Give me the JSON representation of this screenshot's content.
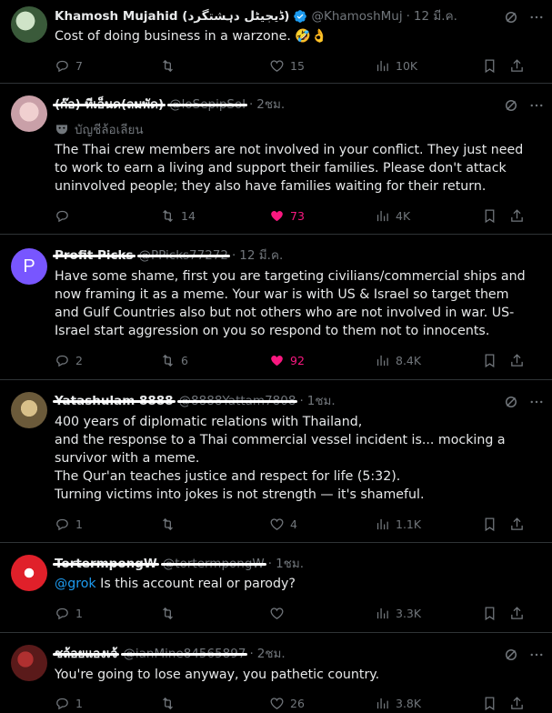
{
  "tweets": [
    {
      "name": "Khamosh Mujahid (ڈیجیٹل دہشتگرد)",
      "verified": true,
      "handle": "@KhamoshMuj",
      "time": "12 มี.ค.",
      "text": [
        "Cost of doing business in a warzone. 🤣👌"
      ],
      "replies": "7",
      "retweets": "",
      "likes": "15",
      "views": "10K",
      "liked": false,
      "avatar_color": "#3a5a3a"
    },
    {
      "name": "(ก๊อ) ทีเอ็นด(ลมพัด)",
      "handle": "@loSepipSol",
      "time": "2ชม.",
      "sub": "บัญชีล้อเลียน",
      "text": [
        "The Thai crew members are not involved in your conflict. They just need to work to earn a living and support their families. Please don't attack uninvolved people; they also have families waiting for their return."
      ],
      "replies": "",
      "retweets": "14",
      "likes": "73",
      "views": "4K",
      "liked": true,
      "avatar_color": "#c9a0a8"
    },
    {
      "name": "Profit Picks",
      "handle": "@PPicks77272",
      "time": "12 มี.ค.",
      "avatar_letter": "P",
      "text": [
        "Have some shame, first you are targeting civilians/commercial ships and now framing it as a meme. Your war is with US & Israel so target them and Gulf Countries also but not others who are not involved in war. US-Israel start aggression on you so respond to them not to innocents."
      ],
      "replies": "2",
      "retweets": "6",
      "likes": "92",
      "views": "8.4K",
      "liked": true,
      "avatar_color": "#7856ff"
    },
    {
      "name": "Yatashulam 8888",
      "handle": "@8888Yattam7808",
      "time": "1ชม.",
      "text": [
        "400 years of diplomatic relations with Thailand,",
        "and the response to a Thai commercial vessel incident is... mocking a survivor with a meme.",
        "The Qur'an teaches justice and respect for life (5:32).",
        "Turning victims into jokes is not strength — it's shameful."
      ],
      "replies": "1",
      "retweets": "",
      "likes": "4",
      "views": "1.1K",
      "liked": false,
      "avatar_color": "#6b5a3a"
    },
    {
      "name": "TortermpongW",
      "handle": "@tortermpongW",
      "time": "1ชม.",
      "mention": "@grok",
      "text": [
        "Is this account real or parody?"
      ],
      "replies": "1",
      "retweets": "",
      "likes": "",
      "views": "3.3K",
      "liked": false,
      "avatar_color": "#e0202a"
    },
    {
      "name": "ชล้อยแองเจ้",
      "handle": "@ianMine84565897",
      "time": "2ชม.",
      "text": [
        "You're going to lose anyway, you pathetic country."
      ],
      "replies": "1",
      "retweets": "",
      "likes": "26",
      "views": "3.8K",
      "liked": false,
      "avatar_color": "#5a1a1a"
    }
  ],
  "icons": {
    "reply": "reply-icon",
    "retweet": "retweet-icon",
    "like": "like-icon",
    "views": "views-icon",
    "bookmark": "bookmark-icon",
    "share": "share-icon",
    "grok": "grok-icon",
    "more": "more-icon",
    "verified": "verified-badge-icon",
    "parody": "parody-mask-icon"
  },
  "colors": {
    "link": "#1d9bf0",
    "like": "#f91880",
    "muted": "#71767b",
    "text": "#e7e9ea",
    "divider": "#2f3336"
  }
}
